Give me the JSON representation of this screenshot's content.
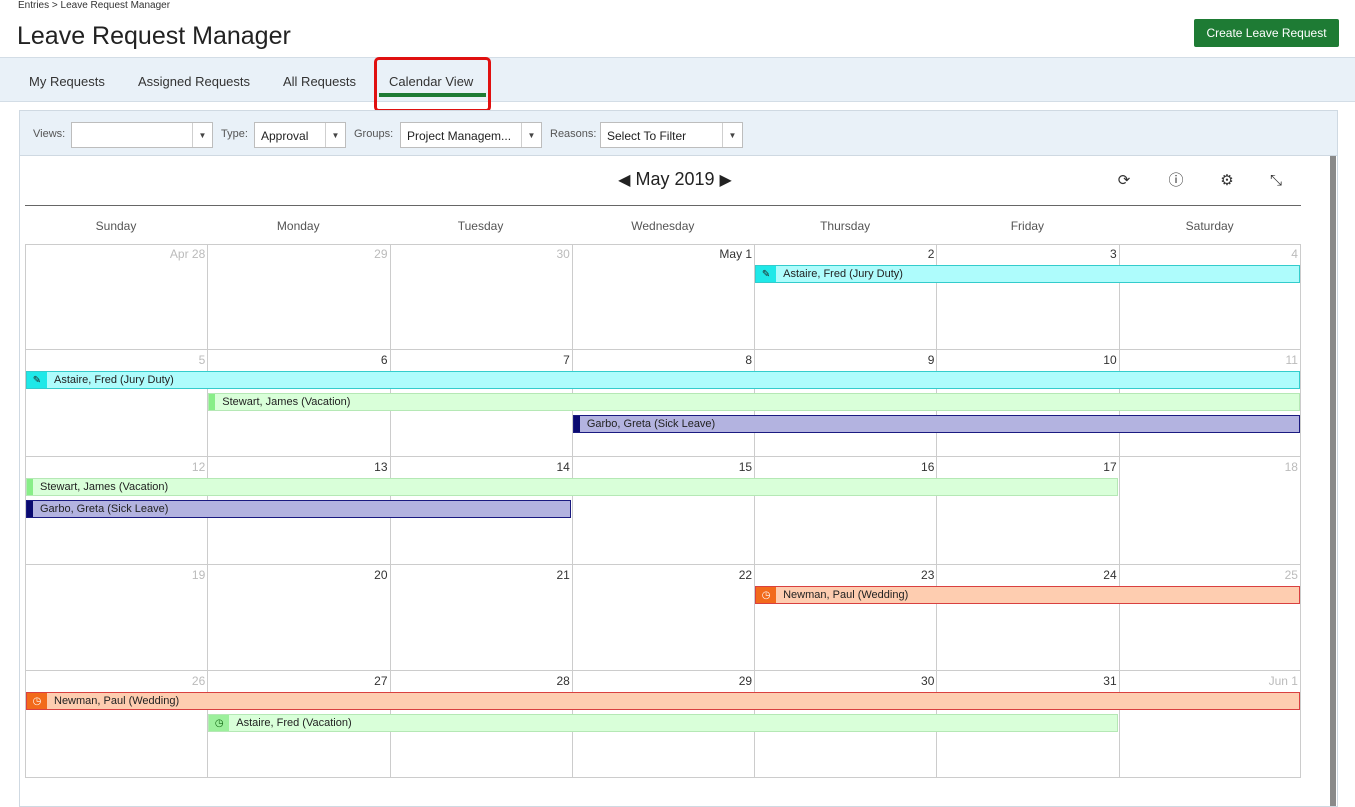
{
  "header": {
    "breadcrumb": "Entries > Leave Request Manager",
    "title": "Leave Request Manager",
    "create_button": "Create Leave Request"
  },
  "tabs": [
    {
      "label": "My Requests"
    },
    {
      "label": "Assigned Requests"
    },
    {
      "label": "All Requests"
    },
    {
      "label": "Calendar View",
      "active": true
    }
  ],
  "filters": {
    "views_label": "Views:",
    "views_value": "",
    "type_label": "Type:",
    "type_value": "Approval",
    "groups_label": "Groups:",
    "groups_value": "Project Managem...",
    "reasons_label": "Reasons:",
    "reasons_value": "Select To Filter"
  },
  "calendar": {
    "month_label": "May 2019",
    "prev_glyph": "◀",
    "next_glyph": "▶",
    "days_of_week": [
      "Sunday",
      "Monday",
      "Tuesday",
      "Wednesday",
      "Thursday",
      "Friday",
      "Saturday"
    ],
    "weeks": [
      {
        "days": [
          {
            "label": "Apr 28",
            "other": true
          },
          {
            "label": "29",
            "other": true
          },
          {
            "label": "30",
            "other": true
          },
          {
            "label": "May 1",
            "other": false
          },
          {
            "label": "2",
            "other": false
          },
          {
            "label": "3",
            "other": false
          },
          {
            "label": "4",
            "other": true
          }
        ],
        "events": [
          {
            "text": "Astaire, Fred (Jury Duty)",
            "start": 4,
            "end": 6,
            "row": 0,
            "style": "jury"
          }
        ]
      },
      {
        "days": [
          {
            "label": "5",
            "other": true
          },
          {
            "label": "6",
            "other": false
          },
          {
            "label": "7",
            "other": false
          },
          {
            "label": "8",
            "other": false
          },
          {
            "label": "9",
            "other": false
          },
          {
            "label": "10",
            "other": false
          },
          {
            "label": "11",
            "other": true
          }
        ],
        "events": [
          {
            "text": "Astaire, Fred (Jury Duty)",
            "start": 0,
            "end": 6,
            "row": 0,
            "style": "jury"
          },
          {
            "text": "Stewart, James (Vacation)",
            "start": 1,
            "end": 6,
            "row": 1,
            "style": "vacation"
          },
          {
            "text": "Garbo, Greta (Sick Leave)",
            "start": 3,
            "end": 6,
            "row": 2,
            "style": "sick"
          }
        ]
      },
      {
        "days": [
          {
            "label": "12",
            "other": true
          },
          {
            "label": "13",
            "other": false
          },
          {
            "label": "14",
            "other": false
          },
          {
            "label": "15",
            "other": false
          },
          {
            "label": "16",
            "other": false
          },
          {
            "label": "17",
            "other": false
          },
          {
            "label": "18",
            "other": true
          }
        ],
        "events": [
          {
            "text": "Stewart, James (Vacation)",
            "start": 0,
            "end": 5,
            "row": 0,
            "style": "vacation"
          },
          {
            "text": "Garbo, Greta (Sick Leave)",
            "start": 0,
            "end": 2,
            "row": 1,
            "style": "sick"
          }
        ]
      },
      {
        "days": [
          {
            "label": "19",
            "other": true
          },
          {
            "label": "20",
            "other": false
          },
          {
            "label": "21",
            "other": false
          },
          {
            "label": "22",
            "other": false
          },
          {
            "label": "23",
            "other": false
          },
          {
            "label": "24",
            "other": false
          },
          {
            "label": "25",
            "other": true
          }
        ],
        "events": [
          {
            "text": "Newman, Paul (Wedding)",
            "start": 4,
            "end": 6,
            "row": 0,
            "style": "wedding"
          }
        ]
      },
      {
        "days": [
          {
            "label": "26",
            "other": true
          },
          {
            "label": "27",
            "other": false
          },
          {
            "label": "28",
            "other": false
          },
          {
            "label": "29",
            "other": false
          },
          {
            "label": "30",
            "other": false
          },
          {
            "label": "31",
            "other": false
          },
          {
            "label": "Jun 1",
            "other": true
          }
        ],
        "events": [
          {
            "text": "Newman, Paul (Wedding)",
            "start": 0,
            "end": 6,
            "row": 0,
            "style": "wedding"
          },
          {
            "text": "Astaire, Fred (Vacation)",
            "start": 1,
            "end": 5,
            "row": 1,
            "style": "vacation-pending"
          }
        ]
      }
    ]
  },
  "event_styles": {
    "jury": {
      "bg": "#aefcfc",
      "border": "#33cccc",
      "icon": "pencil-icon",
      "glyph": "✎",
      "icon_bg": "#1fe8e8",
      "icon_color": "#222"
    },
    "vacation": {
      "bg": "#d9ffd9",
      "border": "#b5e8b5",
      "bar": "#88ee88"
    },
    "vacation-pending": {
      "bg": "#d9ffd9",
      "border": "#b5e8b5",
      "icon": "clock-icon",
      "glyph": "◷",
      "icon_bg": "#9cf09c",
      "icon_color": "#116611"
    },
    "sick": {
      "bg": "#b3b3e0",
      "border": "#1a1a80",
      "bar": "#0a0a70"
    },
    "wedding": {
      "bg": "#fecdb0",
      "border": "#d94040",
      "icon": "clock-icon",
      "glyph": "◷",
      "icon_bg": "#f26a1b",
      "icon_color": "#ffffff"
    }
  },
  "toolbar_icons": [
    {
      "name": "refresh-icon",
      "glyph": "⟳"
    },
    {
      "name": "info-icon",
      "glyph": "ⓘ"
    },
    {
      "name": "settings-icon",
      "glyph": "⚙"
    },
    {
      "name": "collapse-icon",
      "glyph": "⤡"
    }
  ],
  "colors": {
    "accent_green": "#1e7b34",
    "highlight_red": "#e01010"
  }
}
